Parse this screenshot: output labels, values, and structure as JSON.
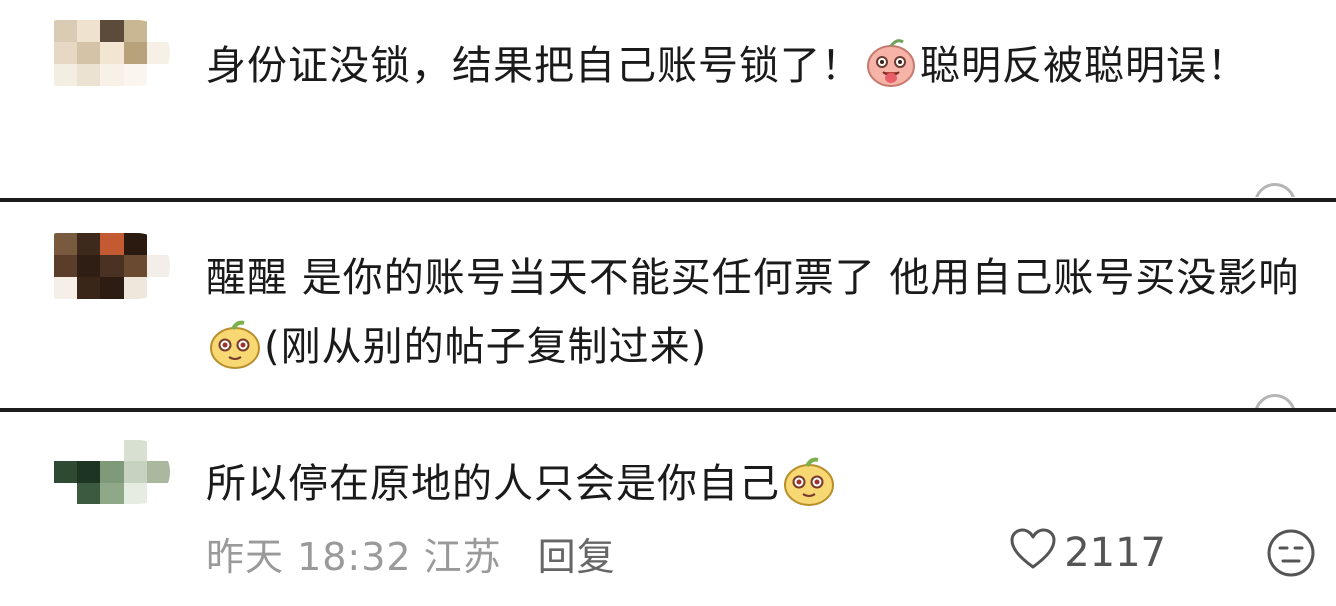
{
  "comments": [
    {
      "text_before_emoji": "身份证没锁，结果把自己账号锁了！",
      "emoji": "tongue-out-peach-emoji",
      "text_after_emoji": "聪明反被聪明误！"
    },
    {
      "text_before_emoji": "醒醒 是你的账号当天不能买任何票了 他用自己账号买没影响",
      "emoji": "smirk-bean-emoji",
      "text_after_emoji": "(刚从别的帖子复制过来)"
    },
    {
      "text_before_emoji": "所以停在原地的人只会是你自己",
      "emoji": "smirk-bean-emoji",
      "text_after_emoji": "",
      "time": "昨天 18:32",
      "location": "江苏",
      "reply_label": "回复",
      "like_icon": "heart-outline-icon",
      "like_count": "2117",
      "reaction_icon": "neutral-face-icon"
    }
  ],
  "colors": {
    "text": "#1a1a1a",
    "meta": "#9a9a9a",
    "divider": "#1c1c1c",
    "background": "#ffffff"
  }
}
